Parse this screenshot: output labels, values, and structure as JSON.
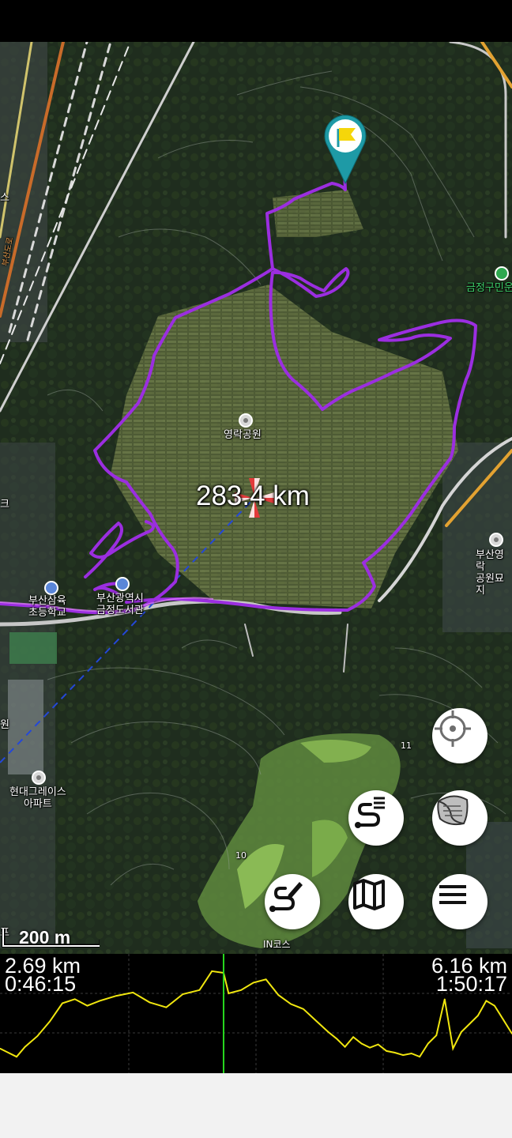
{
  "map": {
    "labels": {
      "park": "영락공원",
      "school": "부산삼육\n초등학교",
      "library": "부산광역시\n금정도서관",
      "apartment": "현대그레이스\n아파트",
      "cemetery": "부산영락\n공원묘지",
      "district_office": "금정구민운",
      "in_course": "IN코스",
      "hole_11": "11",
      "hole_10": "10",
      "edge_label_1": "스",
      "edge_label_2": "크",
      "edge_label_3": "원",
      "edge_label_4": "프",
      "road_vertical": "부산도로"
    },
    "distance_readout": "283.4 km",
    "scale_label": "200 m",
    "colors": {
      "track": "#9b2ee0",
      "crosshair": "#e23b3b",
      "marker": "#1e9aa6",
      "flag": "#f5d60a",
      "elevation_line": "#f0e60f",
      "current_position": "#27d81f"
    }
  },
  "controls": {
    "locate_icon": "crosshair-icon",
    "layers_icon": "layers-icon",
    "track_list_icon": "track-list-icon",
    "edit_route_icon": "edit-route-icon",
    "map_icon": "map-icon",
    "menu_icon": "menu-icon"
  },
  "elevation": {
    "left_distance": "2.69 km",
    "left_time": "0:46:15",
    "right_distance": "6.16 km",
    "right_time": "1:50:17",
    "chart_data": {
      "type": "line",
      "title": "",
      "xlabel": "",
      "ylabel": "",
      "x_range_km": [
        0,
        6.16
      ],
      "current_position_km": 2.69,
      "series": [
        {
          "x": [
            0.0,
            0.1,
            0.2,
            0.3,
            0.45,
            0.6,
            0.75,
            0.9,
            1.05,
            1.2,
            1.4,
            1.6,
            1.8,
            2.0,
            2.2,
            2.4,
            2.55,
            2.69,
            2.75,
            2.9,
            3.05,
            3.2,
            3.35,
            3.5,
            3.65,
            3.8,
            3.95,
            4.05,
            4.15,
            4.25,
            4.35,
            4.45,
            4.55,
            4.65,
            4.75,
            4.85,
            4.95,
            5.05,
            5.15,
            5.25,
            5.35,
            5.45,
            5.55,
            5.65,
            5.75,
            5.85,
            5.95,
            6.05,
            6.16
          ],
          "values": [
            30,
            25,
            20,
            32,
            45,
            63,
            85,
            90,
            82,
            88,
            94,
            98,
            86,
            80,
            96,
            101,
            124,
            122,
            97,
            101,
            110,
            114,
            95,
            84,
            78,
            64,
            50,
            42,
            32,
            44,
            36,
            31,
            35,
            27,
            25,
            22,
            24,
            20,
            36,
            46,
            90,
            30,
            50,
            60,
            70,
            88,
            82,
            66,
            48
          ]
        }
      ]
    }
  }
}
